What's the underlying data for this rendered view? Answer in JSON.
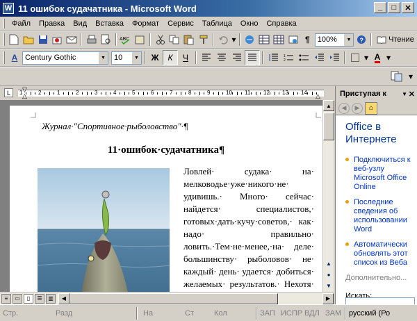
{
  "window": {
    "title": "11 ошибок судачатника - Microsoft Word",
    "app_icon": "W"
  },
  "menu": [
    "Файл",
    "Правка",
    "Вид",
    "Вставка",
    "Формат",
    "Сервис",
    "Таблица",
    "Окно",
    "Справка"
  ],
  "toolbar": {
    "zoom": "100%",
    "reading_label": "Чтение"
  },
  "format": {
    "font": "Century Gothic",
    "size": "10",
    "bold": "Ж",
    "italic": "К",
    "underline": "Ч"
  },
  "ruler": {
    "numbers": [
      "1",
      "2",
      "1",
      "2",
      "3",
      "4",
      "5",
      "6",
      "7",
      "8",
      "9",
      "10",
      "11",
      "12",
      "13",
      "14"
    ]
  },
  "document": {
    "header": "Журнал·\"Спортивное·рыболовство\"·¶",
    "title": "11·ошибок·судачатника¶",
    "body": "Ловлей· судака· на· мелководье·уже·никого·не· удивишь.· Много· сейчас· найдется· специалистов,· готовых·дать·кучу·советов,· как· надо· правильно· ловить.·Тем·не·менее,·на· деле· большинству· рыболовов· не· каждый· день· удается· добиться· желаемых· результатов.· Нехотя· обычно·"
  },
  "taskpane": {
    "header": "Приступая к",
    "title": "Office в Интернете",
    "links": [
      "Подключиться к веб-узлу Microsoft Office Online",
      "Последние сведения об использовании Word",
      "Автоматически обновлять этот список из Веба"
    ],
    "more": "Дополнительно...",
    "search_label": "Искать:"
  },
  "status": {
    "page": "Стр.",
    "section": "Разд",
    "at": "На",
    "line": "Ст",
    "col": "Кол",
    "rec": "ЗАП",
    "trk": "ИСПР",
    "ext": "ВДЛ",
    "ovr": "ЗАМ",
    "lang": "русский (Ро"
  }
}
